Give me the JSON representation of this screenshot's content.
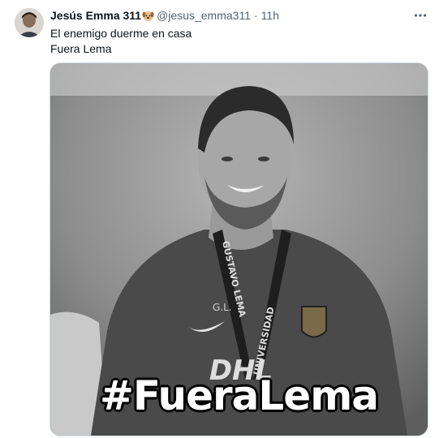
{
  "tweet": {
    "author_name": "Jesús Emma 311",
    "author_emoji": "dog-face",
    "handle": "@jesus_emma311",
    "separator": "·",
    "time": "11h",
    "lines": [
      "El enemigo duerme en casa",
      "Fuera Lema"
    ],
    "image_caption": "#FueraLema",
    "image_shirt_sponsor": "DHL",
    "image_lanyard_left": "GUSTAVO LEMA",
    "image_lanyard_right": "UNIVERSIDAD",
    "image_initials": "G.L."
  },
  "colors": {
    "text_primary": "#0f1419",
    "text_secondary": "#536471",
    "border": "#cfd9de"
  },
  "icons": {
    "more": "more-horizontal-icon",
    "badge": "dog-face-icon"
  }
}
